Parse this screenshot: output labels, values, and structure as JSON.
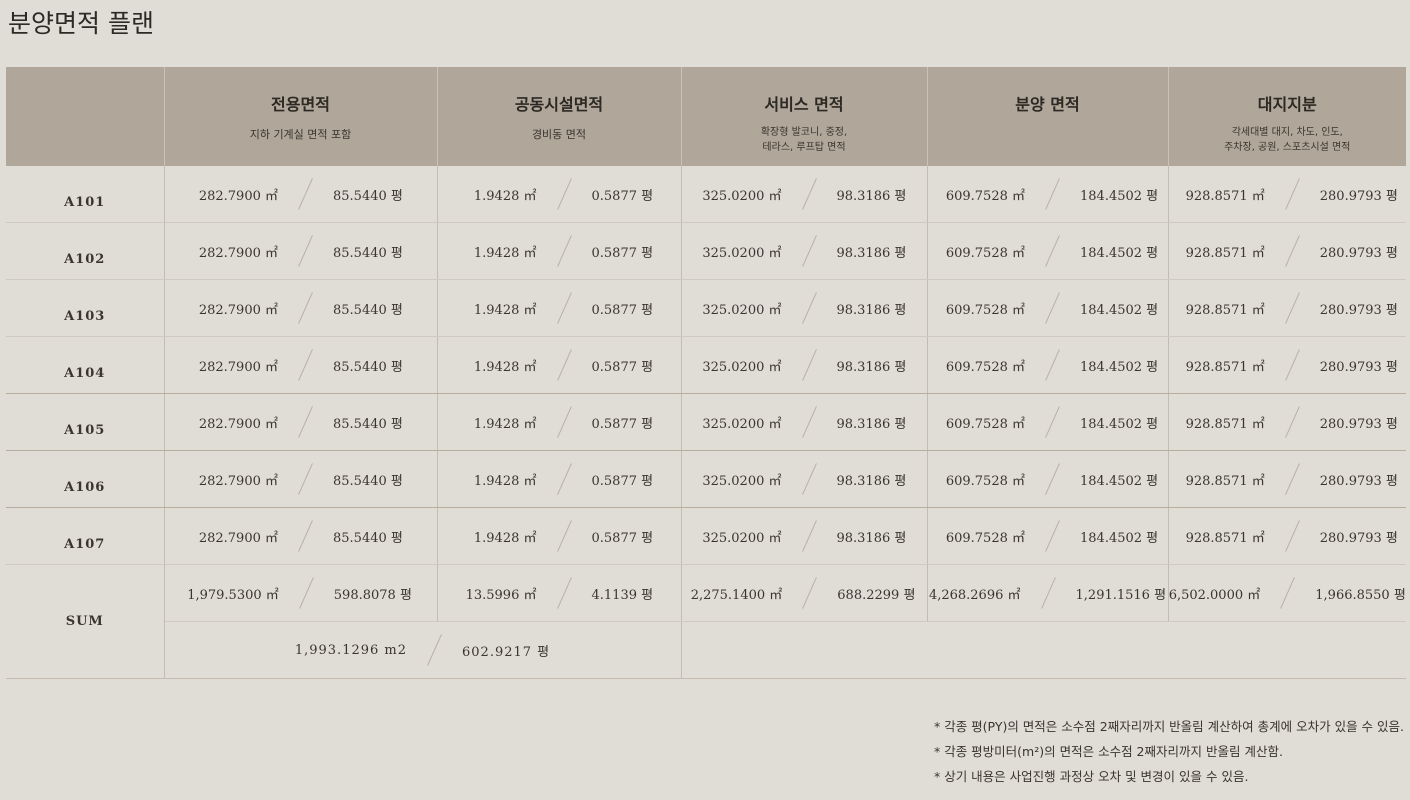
{
  "page_title": "분양면적 플랜",
  "columns": [
    {
      "title": "전용면적",
      "sub": "지하 기계실 면적 포함"
    },
    {
      "title": "공동시설면적",
      "sub": "경비동 면적"
    },
    {
      "title": "서비스 면적",
      "sub": "확장형 발코니, 중정,\n테라스, 루프탑 면적"
    },
    {
      "title": "분양 면적",
      "sub": ""
    },
    {
      "title": "대지지분",
      "sub": "각세대별 대지, 차도, 인도,\n주차장, 공원, 스포츠시설 면적"
    }
  ],
  "rows": [
    {
      "label": "A101",
      "cells": [
        [
          "282.7900 ㎡",
          "85.5440 평"
        ],
        [
          "1.9428 ㎡",
          "0.5877 평"
        ],
        [
          "325.0200 ㎡",
          "98.3186 평"
        ],
        [
          "609.7528 ㎡",
          "184.4502 평"
        ],
        [
          "928.8571 ㎡",
          "280.9793 평"
        ]
      ]
    },
    {
      "label": "A102",
      "cells": [
        [
          "282.7900 ㎡",
          "85.5440 평"
        ],
        [
          "1.9428 ㎡",
          "0.5877 평"
        ],
        [
          "325.0200 ㎡",
          "98.3186 평"
        ],
        [
          "609.7528 ㎡",
          "184.4502 평"
        ],
        [
          "928.8571 ㎡",
          "280.9793 평"
        ]
      ]
    },
    {
      "label": "A103",
      "cells": [
        [
          "282.7900 ㎡",
          "85.5440 평"
        ],
        [
          "1.9428 ㎡",
          "0.5877 평"
        ],
        [
          "325.0200 ㎡",
          "98.3186 평"
        ],
        [
          "609.7528 ㎡",
          "184.4502 평"
        ],
        [
          "928.8571 ㎡",
          "280.9793 평"
        ]
      ]
    },
    {
      "label": "A104",
      "cells": [
        [
          "282.7900 ㎡",
          "85.5440 평"
        ],
        [
          "1.9428 ㎡",
          "0.5877 평"
        ],
        [
          "325.0200 ㎡",
          "98.3186 평"
        ],
        [
          "609.7528 ㎡",
          "184.4502 평"
        ],
        [
          "928.8571 ㎡",
          "280.9793 평"
        ]
      ]
    },
    {
      "label": "A105",
      "cells": [
        [
          "282.7900 ㎡",
          "85.5440 평"
        ],
        [
          "1.9428 ㎡",
          "0.5877 평"
        ],
        [
          "325.0200 ㎡",
          "98.3186 평"
        ],
        [
          "609.7528 ㎡",
          "184.4502 평"
        ],
        [
          "928.8571 ㎡",
          "280.9793 평"
        ]
      ]
    },
    {
      "label": "A106",
      "cells": [
        [
          "282.7900 ㎡",
          "85.5440 평"
        ],
        [
          "1.9428 ㎡",
          "0.5877 평"
        ],
        [
          "325.0200 ㎡",
          "98.3186 평"
        ],
        [
          "609.7528 ㎡",
          "184.4502 평"
        ],
        [
          "928.8571 ㎡",
          "280.9793 평"
        ]
      ]
    },
    {
      "label": "A107",
      "cells": [
        [
          "282.7900 ㎡",
          "85.5440 평"
        ],
        [
          "1.9428 ㎡",
          "0.5877 평"
        ],
        [
          "325.0200 ㎡",
          "98.3186 평"
        ],
        [
          "609.7528 ㎡",
          "184.4502 평"
        ],
        [
          "928.8571 ㎡",
          "280.9793 평"
        ]
      ]
    }
  ],
  "sum": {
    "label": "SUM",
    "cells": [
      [
        "1,979.5300 ㎡",
        "598.8078 평"
      ],
      [
        "13.5996 ㎡",
        "4.1139 평"
      ],
      [
        "2,275.1400 ㎡",
        "688.2299 평"
      ],
      [
        "4,268.2696 ㎡",
        "1,291.1516 평"
      ],
      [
        "6,502.0000 ㎡",
        "1,966.8550 평"
      ]
    ],
    "total": [
      "1,993.1296 m2",
      "602.9217 평"
    ]
  },
  "notes": [
    "* 각종 평(PY)의 면적은 소수점 2째자리까지 반올림 계산하여 총계에 오차가 있을 수 있음.",
    "* 각종 평방미터(m²)의 면적은 소수점 2째자리까지 반올림 계산함.",
    "* 상기 내용은 사업진행 과정상 오차 및 변경이 있을 수 있음."
  ]
}
